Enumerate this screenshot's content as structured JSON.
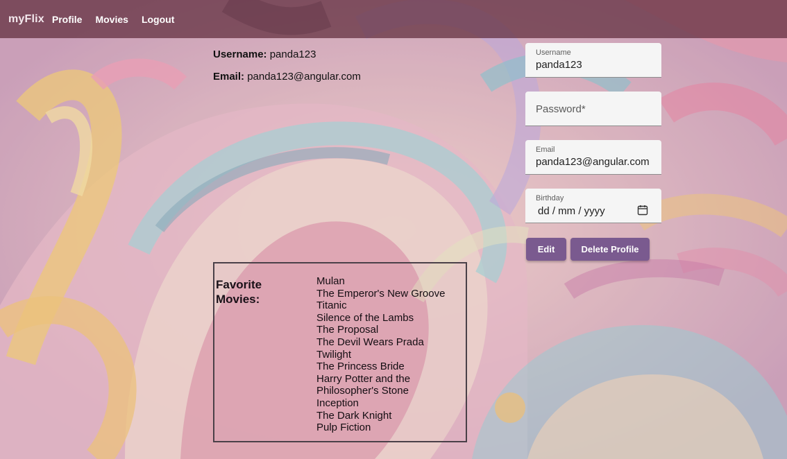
{
  "navbar": {
    "brand": "myFlix",
    "links": [
      "Profile",
      "Movies",
      "Logout"
    ]
  },
  "user_info": {
    "username_label": "Username:",
    "username_value": "panda123",
    "email_label": "Email:",
    "email_value": "panda123@angular.com"
  },
  "favorites": {
    "title": "Favorite Movies:",
    "movies": [
      "Mulan",
      "The Emperor's New Groove",
      "Titanic",
      "Silence of the Lambs",
      "The Proposal",
      "The Devil Wears Prada",
      "Twilight",
      "The Princess Bride",
      "Harry Potter and the Philosopher's Stone",
      "Inception",
      "The Dark Knight",
      "Pulp Fiction"
    ]
  },
  "form": {
    "username": {
      "label": "Username",
      "value": "panda123"
    },
    "password": {
      "placeholder": "Password*"
    },
    "email": {
      "label": "Email",
      "value": "panda123@angular.com"
    },
    "birthday": {
      "label": "Birthday",
      "value": "dd / mm / yyyy",
      "icon": "calendar-icon"
    },
    "edit_label": "Edit",
    "delete_label": "Delete Profile"
  },
  "colors": {
    "navbar": "#5f2d3c",
    "button": "#7a5a8f",
    "field_bg": "#f5f5f5"
  }
}
